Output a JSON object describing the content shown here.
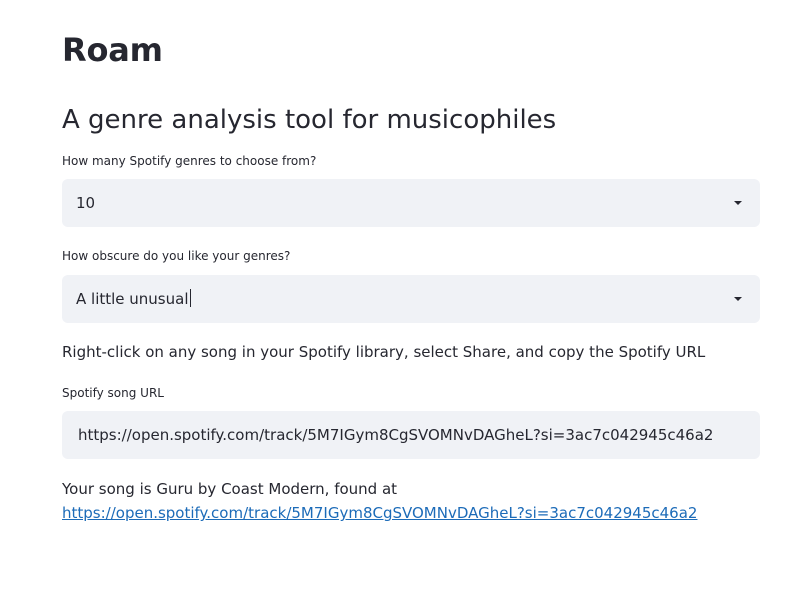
{
  "app": {
    "title": "Roam",
    "subtitle": "A genre analysis tool for musicophiles"
  },
  "genre_count": {
    "label": "How many Spotify genres to choose from?",
    "selected": "10"
  },
  "obscurity": {
    "label": "How obscure do you like your genres?",
    "selected": "A little unusual"
  },
  "instructions": "Right-click on any song in your Spotify library, select Share, and copy the Spotify URL",
  "song_url": {
    "label": "Spotify song URL",
    "value": "https://open.spotify.com/track/5M7IGym8CgSVOMNvDAGheL?si=3ac7c042945c46a2"
  },
  "result": {
    "prefix": "Your song is Guru by Coast Modern, found at",
    "link": "https://open.spotify.com/track/5M7IGym8CgSVOMNvDAGheL?si=3ac7c042945c46a2"
  }
}
